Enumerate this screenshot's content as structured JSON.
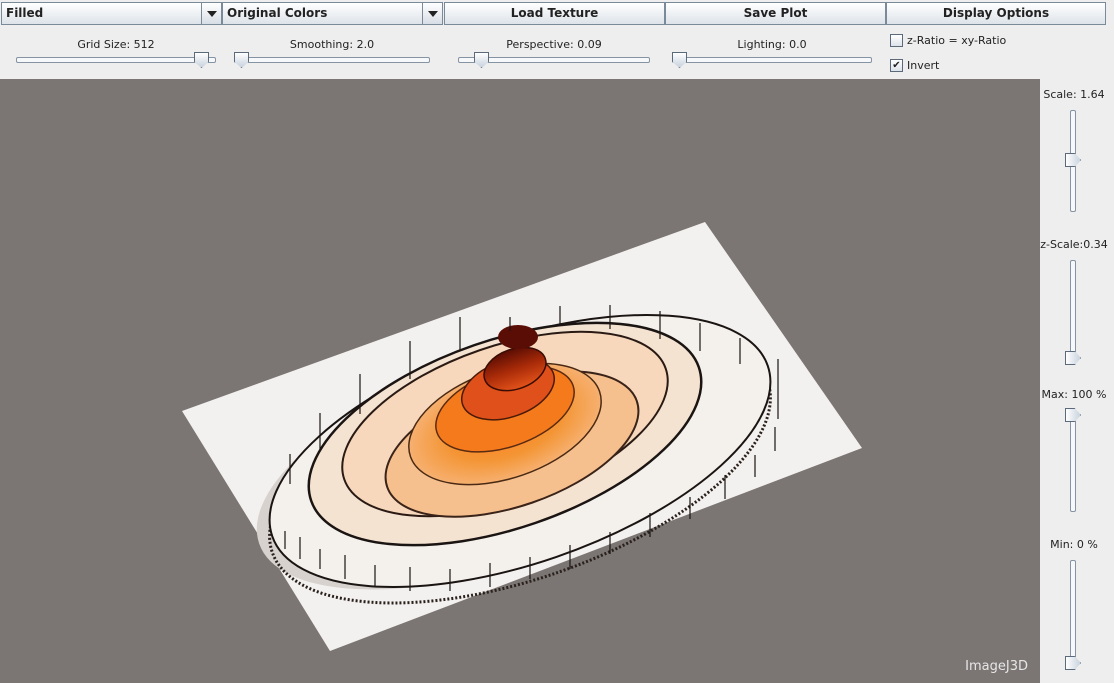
{
  "toolbar": {
    "render_mode": "Filled",
    "color_mode": "Original Colors",
    "load_texture": "Load Texture",
    "save_plot": "Save Plot",
    "display_options": "Display Options"
  },
  "sliders": {
    "grid_size": {
      "label": "Grid Size: 512",
      "level": 0.96
    },
    "smoothing": {
      "label": "Smoothing: 2.0",
      "level": 0.0
    },
    "perspective": {
      "label": "Perspective: 0.09",
      "level": 0.09
    },
    "lighting": {
      "label": "Lighting: 0.0",
      "level": 0.0
    }
  },
  "options": {
    "z_ratio_label": "z-Ratio = xy-Ratio",
    "z_ratio_checked": false,
    "invert_label": "Invert",
    "invert_checked": true,
    "check_mark": "✔"
  },
  "side": {
    "scale": {
      "label": "Scale: 1.64",
      "level": 0.5
    },
    "z_scale": {
      "label": "z-Scale:0.34",
      "level": 0.0
    },
    "max": {
      "label": "Max: 100 %",
      "level": 1.0
    },
    "min": {
      "label": "Min: 0 %",
      "level": 0.0
    }
  },
  "watermark": "ImageJ3D",
  "colors": {
    "viewport_bg": "#7b7673",
    "plane": "#f3f1ef",
    "ring_edge": "#1a1412",
    "peak_dark": "#7a1506",
    "peak_red": "#d8400f",
    "orange": "#f08a2a",
    "light_orange": "#f7c79a",
    "cream": "#f5e3d2"
  }
}
